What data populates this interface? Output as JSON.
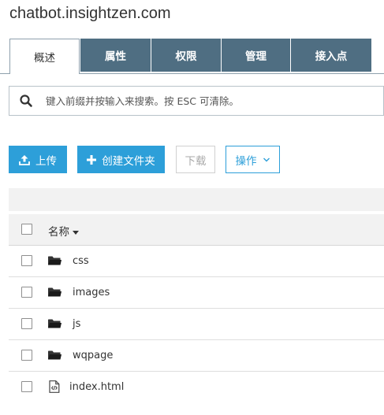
{
  "app": {
    "title": "chatbot.insightzen.com"
  },
  "tabs": [
    {
      "label": "概述",
      "active": true
    },
    {
      "label": "属性",
      "active": false
    },
    {
      "label": "权限",
      "active": false
    },
    {
      "label": "管理",
      "active": false
    },
    {
      "label": "接入点",
      "active": false
    }
  ],
  "search": {
    "placeholder": "键入前缀并按输入来搜索。按 ESC 可清除。",
    "value": ""
  },
  "toolbar": {
    "upload_label": "上传",
    "create_folder_label": "创建文件夹",
    "download_label": "下载",
    "actions_label": "操作"
  },
  "table": {
    "column_name": "名称",
    "rows": [
      {
        "name": "css",
        "type": "folder"
      },
      {
        "name": "images",
        "type": "folder"
      },
      {
        "name": "js",
        "type": "folder"
      },
      {
        "name": "wqpage",
        "type": "folder"
      },
      {
        "name": "index.html",
        "type": "file"
      }
    ]
  },
  "colors": {
    "tab_bg": "#4f6e82",
    "primary": "#2d9fd9"
  },
  "icons": {
    "search": "search-icon",
    "upload": "upload-icon",
    "plus": "plus-icon",
    "chevron": "chevron-down-icon",
    "folder": "folder-icon",
    "file": "html-file-icon"
  }
}
